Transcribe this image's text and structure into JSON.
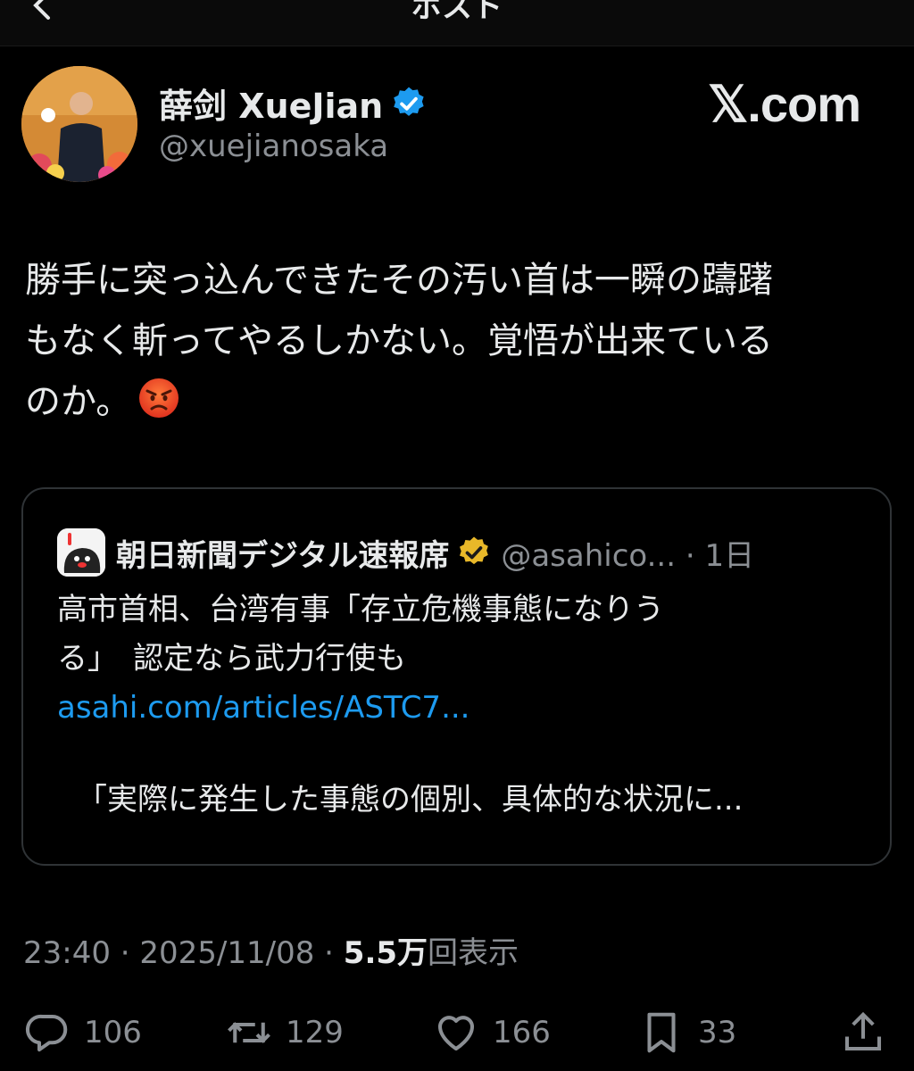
{
  "header": {
    "title": "ポスト",
    "back_label": "<"
  },
  "author": {
    "name": "薛剑 XueJian",
    "handle": "@xuejianosaka"
  },
  "watermark": "𝕏.com",
  "post": {
    "lines": [
      "勝手に突っ込んできたその汚い首は一瞬の躊躇",
      "もなく斬ってやるしかない。覚悟が出来ている",
      "のか。"
    ]
  },
  "quote": {
    "name": "朝日新聞デジタル速報席",
    "handle": "@asahico... · 1日",
    "text_lines": [
      "高市首相、台湾有事「存立危機事態になりう",
      "る」　認定なら武力行使も"
    ],
    "link": "asahi.com/articles/ASTC7...",
    "excerpt": "「実際に発生した事態の個別、具体的な状況に..."
  },
  "meta": {
    "time": "23:40 · 2025/11/08 · ",
    "views_count": "5.5万",
    "views_label": "回表示"
  },
  "actions": {
    "replies": "106",
    "reposts": "129",
    "likes": "166",
    "bookmarks": "33"
  },
  "colors": {
    "background": "#000000",
    "link": "#1d9bf0",
    "verified": "#1d9bf0",
    "gold_badge": "#e8b829"
  },
  "icons": [
    "back-icon",
    "verified-icon",
    "angry-face-icon",
    "gold-verified-icon",
    "reply-icon",
    "repost-icon",
    "like-icon",
    "bookmark-icon",
    "share-icon"
  ]
}
